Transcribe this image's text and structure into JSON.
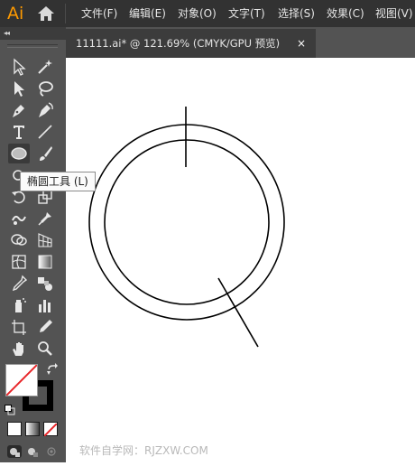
{
  "app": {
    "logo": "Ai"
  },
  "menu": [
    "文件(F)",
    "编辑(E)",
    "对象(O)",
    "文字(T)",
    "选择(S)",
    "效果(C)",
    "视图(V)"
  ],
  "document_tab": {
    "label": "11111.ai* @ 121.69% (CMYK/GPU 预览)",
    "close": "×"
  },
  "toolbar": {
    "collapse": "◂◂"
  },
  "tooltip": {
    "text": "椭圆工具 (L)"
  },
  "watermark": {
    "text": "软件自学网：RJZXW.COM"
  },
  "colors": {
    "menubar_bg": "#323232",
    "toolbar_bg": "#535353",
    "logo": "#ff9a00",
    "canvas": "#ffffff",
    "stroke": "#000000",
    "none_slash": "#e8262a"
  },
  "tools": [
    "selection-tool",
    "direct-selection-tool",
    "magic-wand-tool",
    "lasso-tool",
    "pen-tool",
    "curvature-tool",
    "type-tool",
    "line-segment-tool",
    "ellipse-tool",
    "paintbrush-tool",
    "shaper-tool",
    "eraser-tool",
    "rotate-tool",
    "scale-tool",
    "warp-tool",
    "free-transform-tool",
    "shape-builder-tool",
    "perspective-grid-tool",
    "mesh-tool",
    "gradient-tool",
    "eyedropper-tool",
    "blend-tool",
    "symbol-sprayer-tool",
    "column-graph-tool",
    "artboard-tool",
    "slice-tool",
    "hand-tool",
    "zoom-tool"
  ]
}
